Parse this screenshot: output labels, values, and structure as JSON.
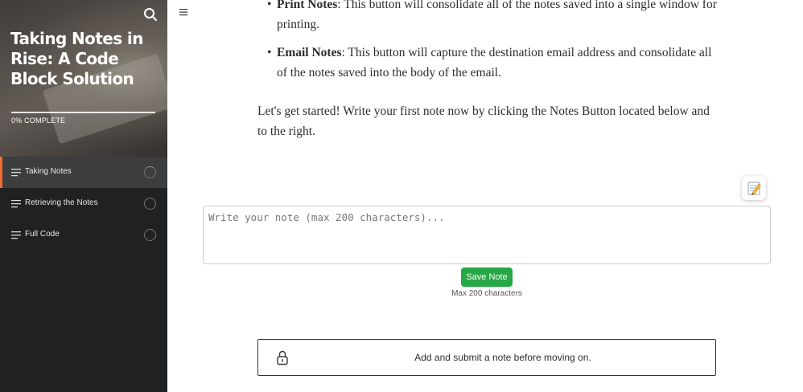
{
  "sidebar": {
    "course_title": "Taking Notes in Rise: A Code Block Solution",
    "progress_label": "0% COMPLETE",
    "progress_value": 0,
    "accent_color": "#f26a31",
    "items": [
      {
        "label": "Taking Notes",
        "active": true,
        "status": "in-progress"
      },
      {
        "label": "Retrieving the Notes",
        "active": false,
        "status": "not-started"
      },
      {
        "label": "Full Code",
        "active": false,
        "status": "not-started"
      }
    ],
    "icons": {
      "search": "search-icon",
      "item": "lines-icon",
      "status": "circle-status-icon"
    }
  },
  "main": {
    "menu_icon": "hamburger-icon",
    "bullets": [
      {
        "term": "Print Notes",
        "desc": ": This button will consolidate all of the notes saved into a single window for printing."
      },
      {
        "term": "Email Notes",
        "desc": ": This button will capture the destination email address and consolidate all of the notes saved into the body of the email."
      }
    ],
    "intro": "Let's get started!  Write your first note now by clicking the Notes Button located below and to the right.",
    "notes_button_icon": "memo-icon",
    "note_placeholder": "Write your note (max 200 characters)...",
    "save_label": "Save Note",
    "save_color": "#28a745",
    "max_label": "Max 200 characters",
    "lock_icon": "lock-icon",
    "lock_message": "Add and submit a note before moving on."
  }
}
